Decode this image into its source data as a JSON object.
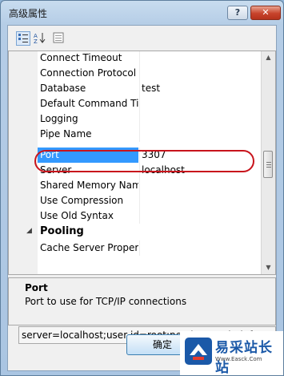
{
  "window": {
    "title": "高级属性",
    "help_label": "?",
    "close_label": "✕"
  },
  "toolbar": {
    "categorized_icon": "categorized-icon",
    "alpha_icon": "alphabetical-sort-icon",
    "pages_icon": "property-pages-icon"
  },
  "grid": {
    "rows": [
      {
        "name": "Connect Timeout",
        "value": ""
      },
      {
        "name": "Connection Protocol",
        "value": ""
      },
      {
        "name": "Database",
        "value": "test"
      },
      {
        "name": "Default Command Timeout",
        "value": ""
      },
      {
        "name": "Logging",
        "value": ""
      },
      {
        "name": "Pipe Name",
        "value": ""
      },
      {
        "name": "Port",
        "value": "3307"
      },
      {
        "name": "Server",
        "value": "localhost"
      },
      {
        "name": "Shared Memory Name",
        "value": ""
      },
      {
        "name": "Use Compression",
        "value": ""
      },
      {
        "name": "Use Old Syntax",
        "value": ""
      },
      {
        "name": "Pooling",
        "value": ""
      },
      {
        "name": "Cache Server Properties",
        "value": ""
      }
    ],
    "selected": "Port"
  },
  "description": {
    "title": "Port",
    "text": "Port to use for TCP/IP connections"
  },
  "connection_string": "server=localhost;user id=root;persistsecurityinfo=True",
  "ok_button": "确定",
  "watermark": {
    "text": "易采站长站",
    "url": "Www.Easck.Com"
  },
  "colors": {
    "selection": "#3399ff",
    "highlight_ring": "#c8141c",
    "close_button": "#c7432b"
  }
}
